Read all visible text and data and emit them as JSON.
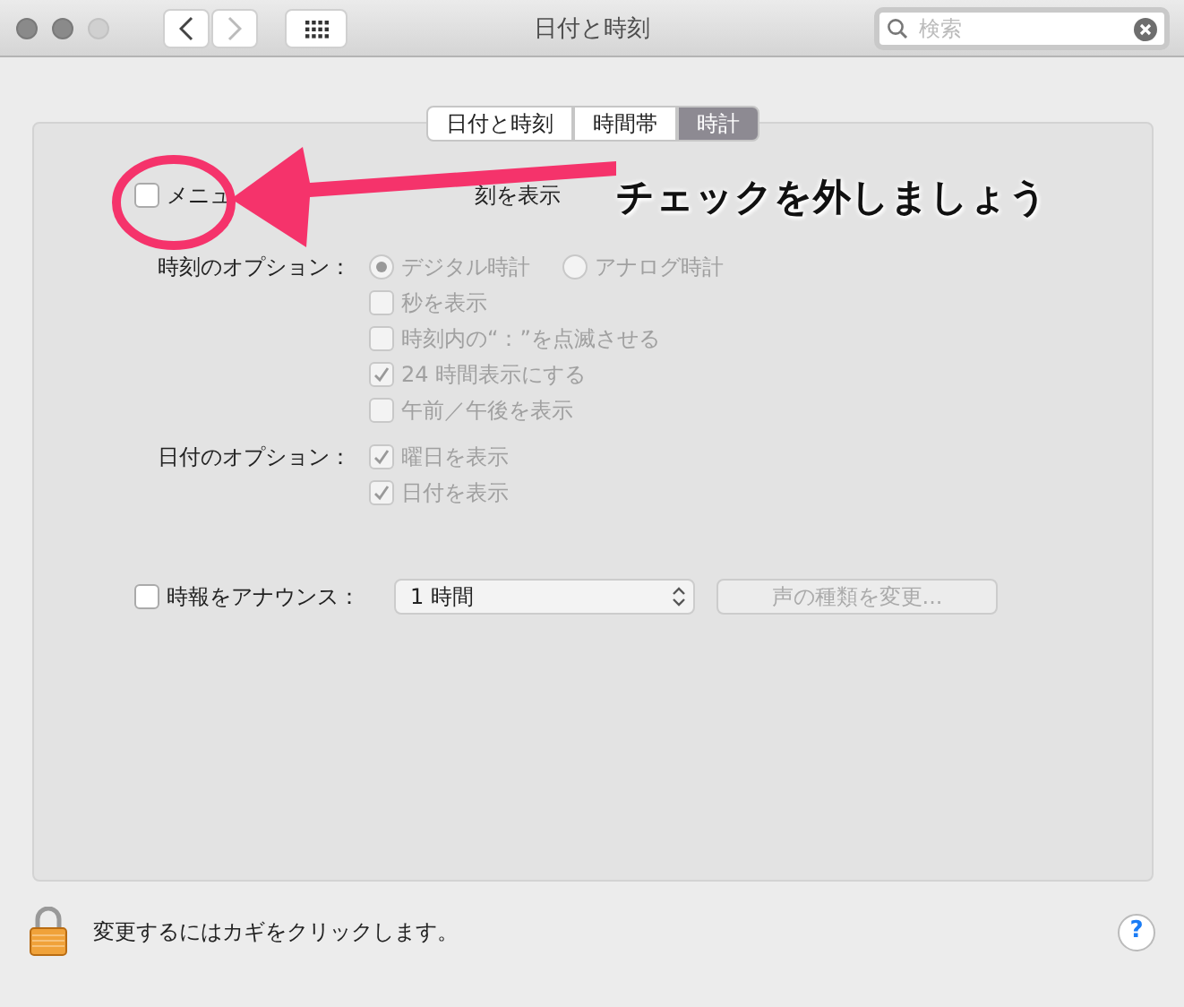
{
  "window": {
    "title": "日付と時刻",
    "search": {
      "placeholder": "検索"
    }
  },
  "tabs": [
    {
      "label": "日付と時刻",
      "selected": false
    },
    {
      "label": "時間帯",
      "selected": false
    },
    {
      "label": "時計",
      "selected": true
    }
  ],
  "menu_clock": {
    "label_start": "メニュ",
    "label_end": "刻を表示",
    "checked": false
  },
  "time_options": {
    "label": "時刻のオプション：",
    "disabled": true,
    "radios": [
      {
        "label": "デジタル時計",
        "selected": true
      },
      {
        "label": "アナログ時計",
        "selected": false
      }
    ],
    "checkboxes": [
      {
        "label": "秒を表示",
        "checked": false
      },
      {
        "label": "時刻内の“：”を点滅させる",
        "checked": false
      },
      {
        "label": "24 時間表示にする",
        "checked": true
      },
      {
        "label": "午前／午後を表示",
        "checked": false
      }
    ]
  },
  "date_options": {
    "label": "日付のオプション：",
    "disabled": true,
    "checkboxes": [
      {
        "label": "曜日を表示",
        "checked": true
      },
      {
        "label": "日付を表示",
        "checked": true
      }
    ]
  },
  "announce": {
    "label": "時報をアナウンス：",
    "checked": false,
    "interval": "1 時間",
    "voice_button": "声の種類を変更..."
  },
  "annotation": {
    "text": "チェックを外しましょう"
  },
  "footer": {
    "lock_text": "変更するにはカギをクリックします。",
    "help": "?"
  }
}
